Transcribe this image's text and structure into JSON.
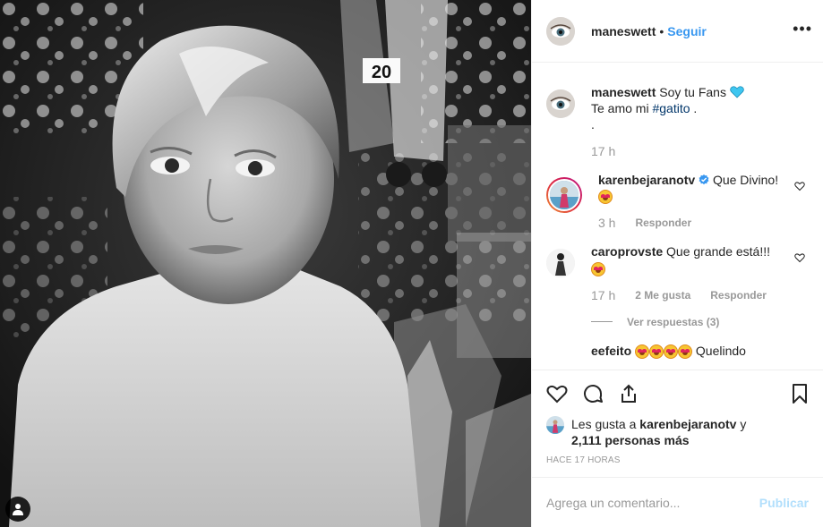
{
  "post": {
    "photo_alt": "Black and white portrait of a child in front of a collage",
    "photo_sign": "20"
  },
  "header": {
    "username": "maneswett",
    "separator": "•",
    "follow_label": "Seguir",
    "more_icon": "more-horizontal-icon"
  },
  "caption": {
    "username": "maneswett",
    "text": "Soy tu Fans",
    "heart_color": "#3ec6f0",
    "line2_prefix": "Te amo mi ",
    "hashtag": "#gatito",
    "line2_suffix": " .",
    "line3": ".",
    "time": "17 h"
  },
  "comments": [
    {
      "username": "karenbejaranotv",
      "verified": true,
      "text": "Que Divino!",
      "time": "3 h",
      "reply_label": "Responder",
      "likes": ""
    },
    {
      "username": "caroprovste",
      "verified": false,
      "text": "Que grande está!!!",
      "time": "17 h",
      "likes": "2 Me gusta",
      "reply_label": "Responder"
    }
  ],
  "view_replies": "Ver respuestas (3)",
  "partial_comment": {
    "username": "eefeito",
    "text": "Quelindo"
  },
  "likes": {
    "prefix": "Les gusta a ",
    "user": "karenbejaranotv",
    "middle": " y",
    "count": "2,111 personas más"
  },
  "timestamp": "HACE 17 HORAS",
  "comment_box": {
    "placeholder": "Agrega un comentario...",
    "publish_label": "Publicar"
  },
  "colors": {
    "accent": "#3897f0",
    "publish_disabled": "#b2dffc",
    "verified": "#3897f0",
    "border": "#efefef"
  }
}
